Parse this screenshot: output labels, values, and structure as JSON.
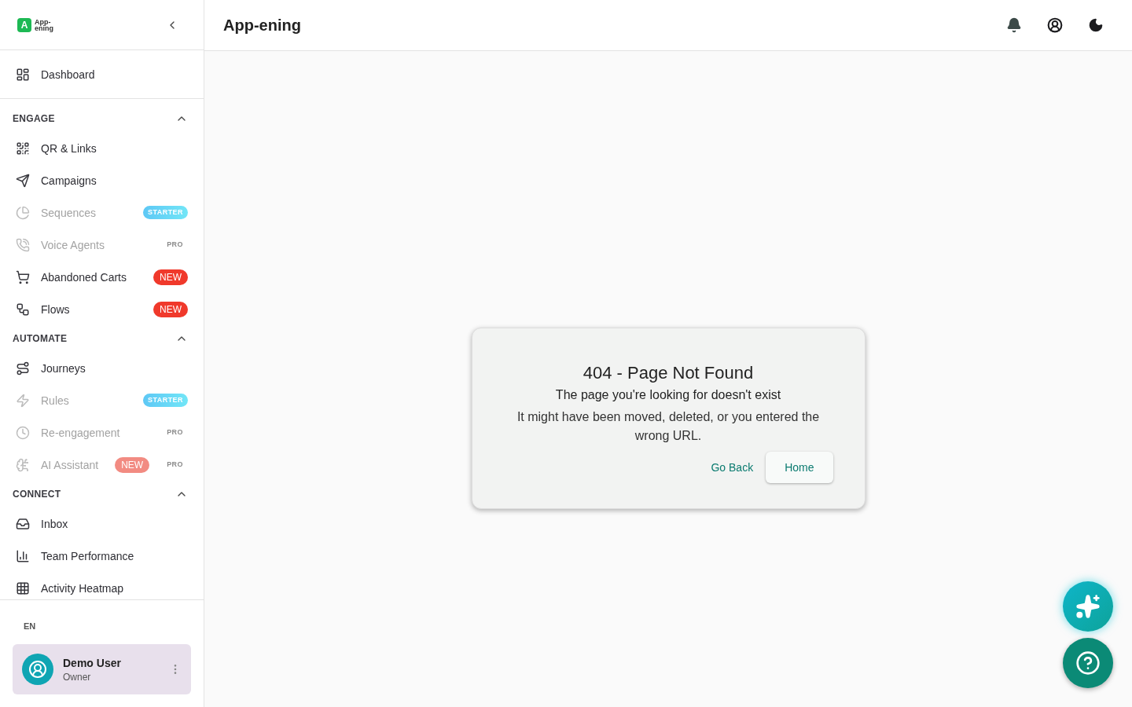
{
  "logo": {
    "mark": "A",
    "line_1": "App-",
    "line_2": "ening"
  },
  "sidebar": {
    "top_items": [
      {
        "label": "Dashboard",
        "disabled": false
      }
    ],
    "sections": [
      {
        "title": "ENGAGE",
        "expanded": true,
        "items": [
          {
            "label": "QR & Links",
            "disabled": false
          },
          {
            "label": "Campaigns",
            "disabled": false
          },
          {
            "label": "Sequences",
            "disabled": true,
            "badges": [
              {
                "kind": "starter",
                "text": "STARTER"
              }
            ]
          },
          {
            "label": "Voice Agents",
            "disabled": true,
            "badges": [
              {
                "kind": "pro",
                "text": "PRO"
              }
            ]
          },
          {
            "label": "Abandoned Carts",
            "disabled": false,
            "badges": [
              {
                "kind": "new",
                "text": "NEW"
              }
            ]
          },
          {
            "label": "Flows",
            "disabled": false,
            "badges": [
              {
                "kind": "new",
                "text": "NEW"
              }
            ]
          }
        ]
      },
      {
        "title": "AUTOMATE",
        "expanded": true,
        "items": [
          {
            "label": "Journeys",
            "disabled": false
          },
          {
            "label": "Rules",
            "disabled": true,
            "badges": [
              {
                "kind": "starter",
                "text": "STARTER"
              }
            ]
          },
          {
            "label": "Re-engagement",
            "disabled": true,
            "badges": [
              {
                "kind": "pro",
                "text": "PRO"
              }
            ]
          },
          {
            "label": "AI Assistant",
            "disabled": true,
            "badges": [
              {
                "kind": "new",
                "text": "NEW"
              },
              {
                "kind": "pro",
                "text": "PRO"
              }
            ]
          }
        ]
      },
      {
        "title": "CONNECT",
        "expanded": true,
        "items": [
          {
            "label": "Inbox",
            "disabled": false
          },
          {
            "label": "Team Performance",
            "disabled": false
          },
          {
            "label": "Activity Heatmap",
            "disabled": false
          }
        ]
      }
    ],
    "language": "EN",
    "user": {
      "name": "Demo User",
      "role": "Owner"
    }
  },
  "header": {
    "title": "App-ening"
  },
  "error_card": {
    "title": "404 - Page Not Found",
    "subtitle": "The page you're looking for doesn't exist",
    "message": "It might have been moved, deleted, or you entered the wrong URL.",
    "buttons": [
      {
        "label": "Go Back",
        "kind": "text"
      },
      {
        "label": "Home",
        "kind": "raised"
      }
    ]
  }
}
